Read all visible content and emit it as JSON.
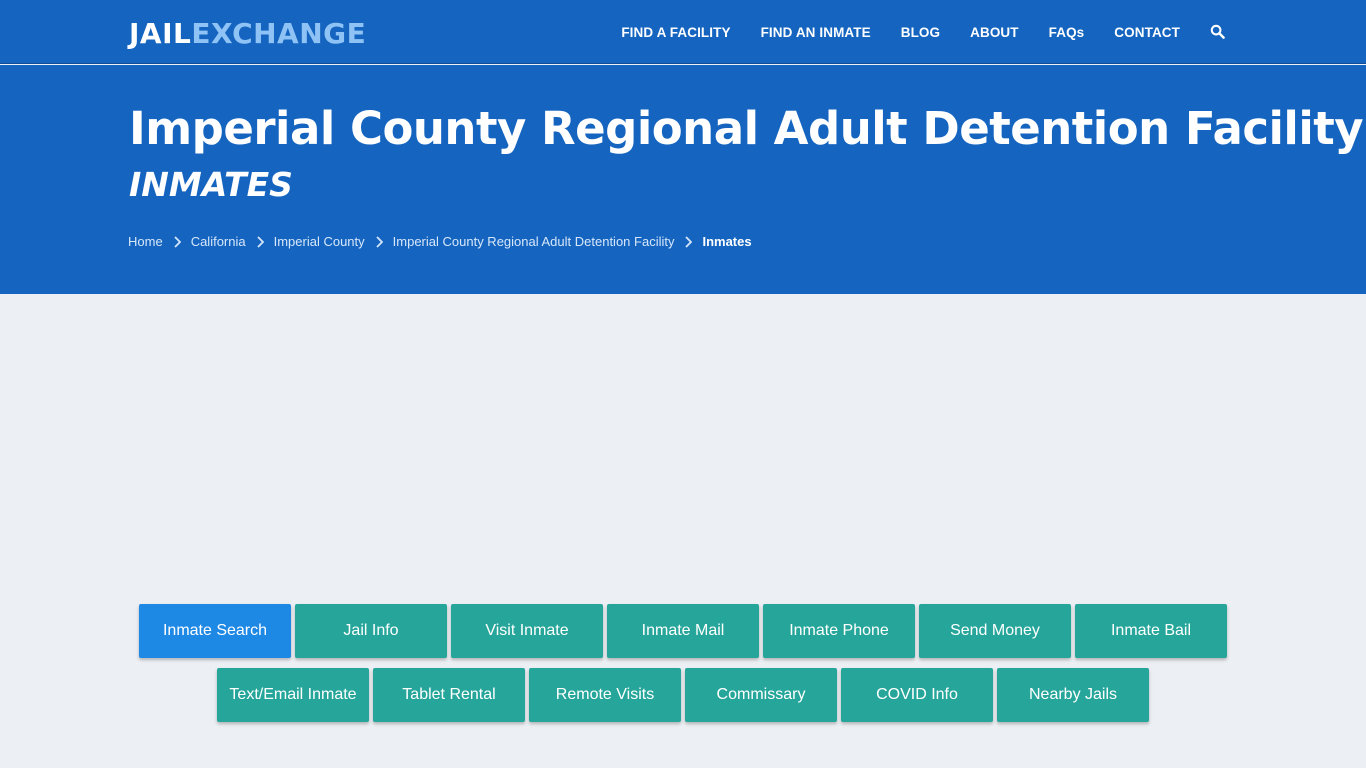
{
  "header": {
    "logo_part1": "JAIL",
    "logo_part2": "EXCHANGE",
    "nav": [
      "FIND A FACILITY",
      "FIND AN INMATE",
      "BLOG",
      "ABOUT",
      "FAQs",
      "CONTACT"
    ],
    "search_icon": "search-icon"
  },
  "hero": {
    "title": "Imperial County Regional Adult Detention Facility",
    "subtitle": "INMATES",
    "breadcrumbs": [
      "Home",
      "California",
      "Imperial County",
      "Imperial County Regional Adult Detention Facility"
    ],
    "current": "Inmates"
  },
  "buttons": {
    "row1": [
      "Inmate Search",
      "Jail Info",
      "Visit Inmate",
      "Inmate Mail",
      "Inmate Phone",
      "Send Money",
      "Inmate Bail"
    ],
    "row2": [
      "Text/Email Inmate",
      "Tablet Rental",
      "Remote Visits",
      "Commissary",
      "COVID Info",
      "Nearby Jails"
    ]
  },
  "colors": {
    "primary": "#1565c0",
    "button": "#26a69a",
    "active_button": "#1e88e5",
    "background": "#eceff3"
  }
}
